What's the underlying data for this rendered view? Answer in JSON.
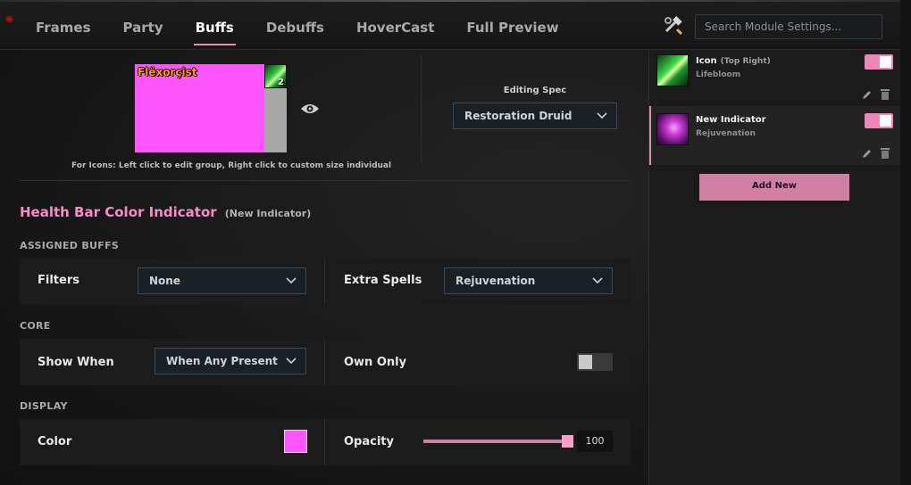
{
  "tabs": [
    {
      "label": "Frames"
    },
    {
      "label": "Party"
    },
    {
      "label": "Buffs"
    },
    {
      "label": "Debuffs"
    },
    {
      "label": "HoverCast"
    },
    {
      "label": "Full Preview"
    }
  ],
  "active_tab": "Buffs",
  "search": {
    "placeholder": "Search Module Settings..."
  },
  "preview": {
    "unit_name": "Flëxorçist",
    "buff_stack": "2",
    "hint": "For Icons: Left click to edit group, Right click to custom size individual"
  },
  "spec": {
    "label": "Editing Spec",
    "value": "Restoration Druid"
  },
  "indicator_title": {
    "main": "Health Bar Color Indicator",
    "sub": "(New Indicator)"
  },
  "sections": {
    "assigned": {
      "label": "ASSIGNED BUFFS",
      "filters_label": "Filters",
      "filters_value": "None",
      "extra_label": "Extra Spells",
      "extra_value": "Rejuvenation"
    },
    "core": {
      "label": "CORE",
      "show_when_label": "Show When",
      "show_when_value": "When Any Present",
      "own_only_label": "Own Only",
      "own_only_enabled": false
    },
    "display": {
      "label": "DISPLAY",
      "color_label": "Color",
      "color_value": "#ff55ff",
      "opacity_label": "Opacity",
      "opacity_value": "100"
    }
  },
  "indicators": [
    {
      "name": "Icon",
      "position": "(Top Right)",
      "spell": "Lifebloom",
      "enabled": true,
      "selected": false,
      "icon": "lifebloom-spell-icon"
    },
    {
      "name": "New Indicator",
      "position": "",
      "spell": "Rejuvenation",
      "enabled": true,
      "selected": true,
      "icon": "rejuvenation-spell-icon"
    }
  ],
  "add_button": "Add New",
  "colors": {
    "accent": "#e58ab0",
    "health": "#ff55ff",
    "panel": "#1b1b1b"
  }
}
